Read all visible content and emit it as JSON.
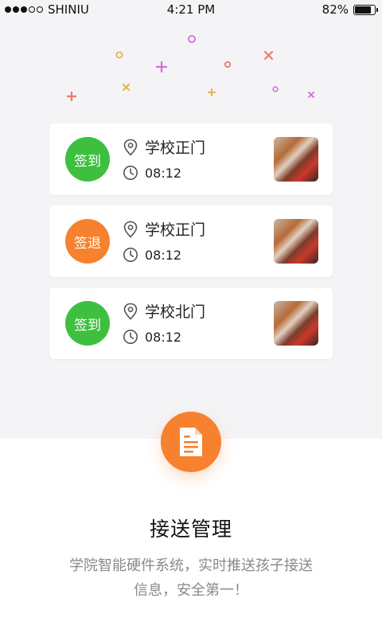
{
  "status_bar": {
    "carrier": "SHINIU",
    "time": "4:21 PM",
    "battery": "82%",
    "battery_level": 0.82
  },
  "cards": [
    {
      "badge": "签到",
      "badge_color": "#3fbf3f",
      "location": "学校正门",
      "time": "08:12"
    },
    {
      "badge": "签退",
      "badge_color": "#f7812e",
      "location": "学校正门",
      "time": "08:12"
    },
    {
      "badge": "签到",
      "badge_color": "#3fbf3f",
      "location": "学校北门",
      "time": "08:12"
    }
  ],
  "feature": {
    "icon": "document-icon",
    "title": "接送管理",
    "description_line1": "学院智能硬件系统，实时推送孩子接送",
    "description_line2": "信息，安全第一！"
  },
  "colors": {
    "green": "#3fbf3f",
    "orange": "#f7812e",
    "background": "#f4f4f6"
  }
}
